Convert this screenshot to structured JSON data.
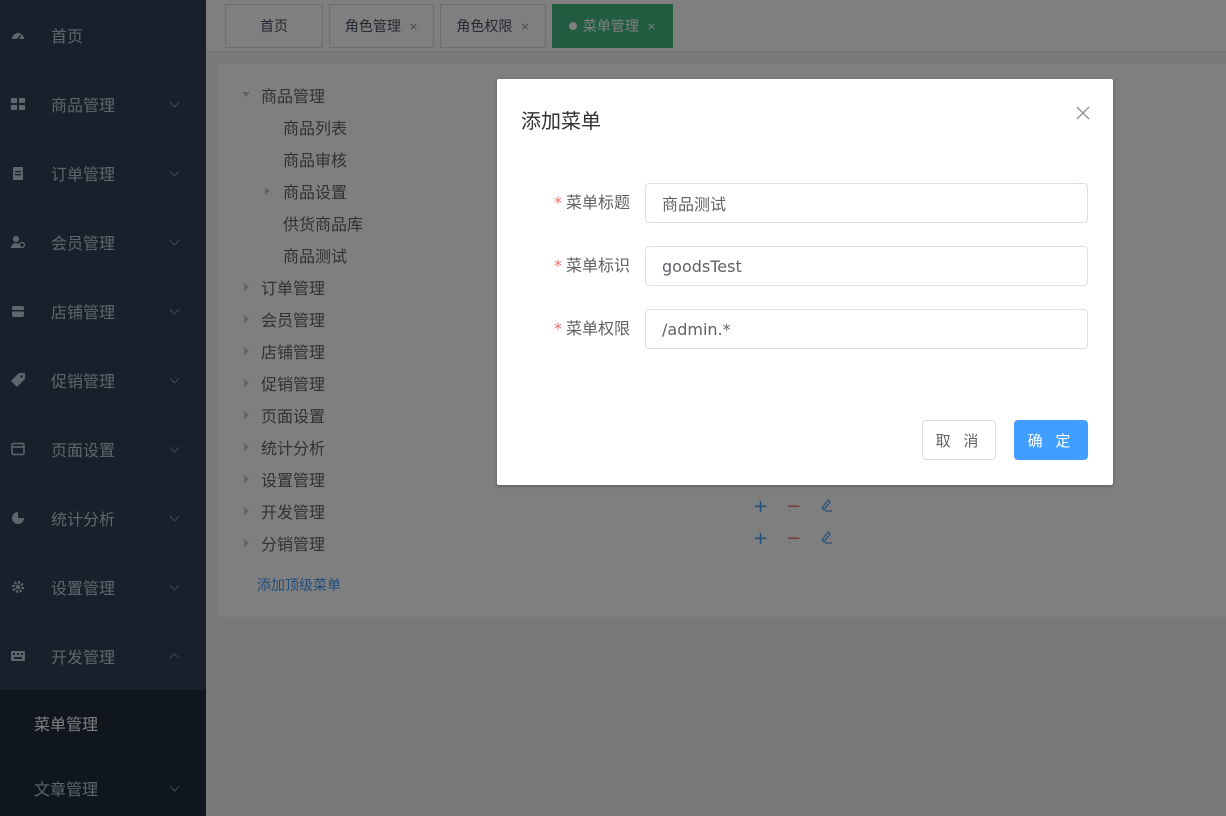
{
  "sidebar": {
    "items": [
      {
        "label": "首页",
        "icon": "dashboard-icon",
        "chevron": false
      },
      {
        "label": "商品管理",
        "icon": "grid-icon",
        "chevron": true
      },
      {
        "label": "订单管理",
        "icon": "clipboard-icon",
        "chevron": true
      },
      {
        "label": "会员管理",
        "icon": "users-icon",
        "chevron": true
      },
      {
        "label": "店铺管理",
        "icon": "store-icon",
        "chevron": true
      },
      {
        "label": "促销管理",
        "icon": "tag-icon",
        "chevron": true
      },
      {
        "label": "页面设置",
        "icon": "window-icon",
        "chevron": true
      },
      {
        "label": "统计分析",
        "icon": "pie-chart-icon",
        "chevron": true
      },
      {
        "label": "设置管理",
        "icon": "gear-icon",
        "chevron": true
      },
      {
        "label": "开发管理",
        "icon": "keyboard-icon",
        "chevron": true
      }
    ],
    "sub_active": "菜单管理",
    "sub_next": "文章管理"
  },
  "tabs": [
    {
      "label": "首页",
      "closable": false,
      "active": false
    },
    {
      "label": "角色管理",
      "closable": true,
      "active": false
    },
    {
      "label": "角色权限",
      "closable": true,
      "active": false
    },
    {
      "label": "菜单管理",
      "closable": true,
      "active": true
    }
  ],
  "tab_close_glyph": "×",
  "tree": {
    "root": "商品管理",
    "children": [
      "商品列表",
      "商品审核",
      "商品设置",
      "供货商品库",
      "商品测试"
    ],
    "others": [
      "订单管理",
      "会员管理",
      "店铺管理",
      "促销管理",
      "页面设置",
      "统计分析",
      "设置管理",
      "开发管理",
      "分销管理"
    ]
  },
  "ops_glyphs": {
    "add": "+",
    "remove": "−"
  },
  "add_top_label": "添加顶级菜单",
  "dialog": {
    "title": "添加菜单",
    "fields": [
      {
        "label": "菜单标题",
        "value": "商品测试"
      },
      {
        "label": "菜单标识",
        "value": "goodsTest"
      },
      {
        "label": "菜单权限",
        "value": "/admin.*"
      }
    ],
    "required_mark": "*",
    "cancel_label": "取 消",
    "ok_label": "确 定"
  },
  "colors": {
    "sidebar_bg": "#304156",
    "active_tab": "#42b983",
    "primary": "#409eff",
    "danger": "#f56c6c"
  }
}
